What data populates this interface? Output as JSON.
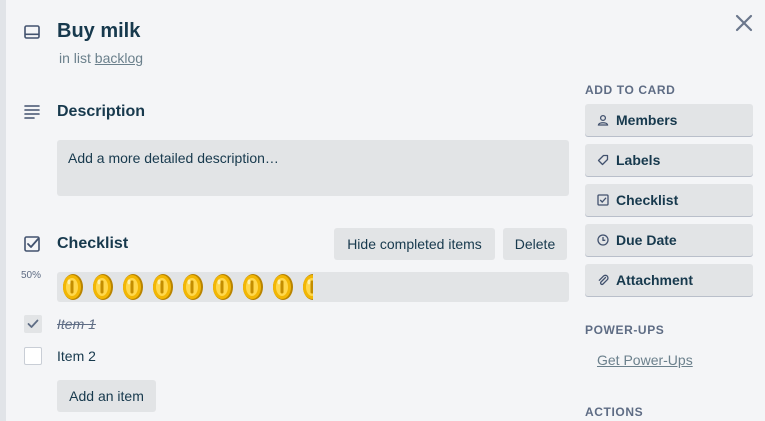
{
  "card": {
    "title": "Buy milk",
    "in_list_prefix": "in list",
    "list_name": "backlog"
  },
  "description": {
    "heading": "Description",
    "placeholder": "Add a more detailed description…"
  },
  "checklist": {
    "heading": "Checklist",
    "hide_completed_label": "Hide completed items",
    "delete_label": "Delete",
    "progress_percent_label": "50%",
    "progress_value": 0.5,
    "items": [
      {
        "label": "Item 1",
        "checked": true
      },
      {
        "label": "Item 2",
        "checked": false
      }
    ],
    "add_item_label": "Add an item"
  },
  "sidebar": {
    "add_to_card_heading": "ADD TO CARD",
    "buttons": [
      {
        "label": "Members",
        "icon": "person-icon"
      },
      {
        "label": "Labels",
        "icon": "tag-icon"
      },
      {
        "label": "Checklist",
        "icon": "checkbox-icon"
      },
      {
        "label": "Due Date",
        "icon": "clock-icon"
      },
      {
        "label": "Attachment",
        "icon": "paperclip-icon"
      }
    ],
    "power_ups_heading": "POWER-UPS",
    "get_power_ups_label": "Get Power-Ups",
    "actions_heading": "ACTIONS"
  },
  "colors": {
    "text": "#17394d",
    "muted": "#6b808c",
    "button_bg": "#e2e4e6",
    "coin_gold": "#f2b705"
  }
}
